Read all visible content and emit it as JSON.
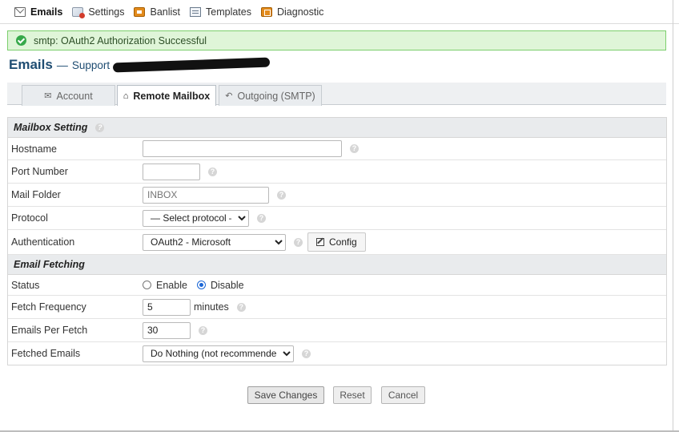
{
  "nav": {
    "items": [
      {
        "label": "Emails",
        "icon": "mail-icon",
        "active": true
      },
      {
        "label": "Settings",
        "icon": "settings-icon"
      },
      {
        "label": "Banlist",
        "icon": "banlist-icon"
      },
      {
        "label": "Templates",
        "icon": "templates-icon"
      },
      {
        "label": "Diagnostic",
        "icon": "diagnostic-icon"
      }
    ]
  },
  "alert": {
    "text": "smtp: OAuth2 Authorization Successful",
    "color": "#dff5d8"
  },
  "title": {
    "main": "Emails",
    "separator": "—",
    "sub": "Support"
  },
  "tabs": [
    {
      "label": "Account",
      "icon": "envelope-icon",
      "active": false
    },
    {
      "label": "Remote Mailbox",
      "icon": "inbox-icon",
      "active": true
    },
    {
      "label": "Outgoing (SMTP)",
      "icon": "reply-icon",
      "active": false
    }
  ],
  "sections": {
    "mailbox": {
      "title": "Mailbox Setting"
    },
    "fetching": {
      "title": "Email Fetching"
    }
  },
  "fields": {
    "hostname": {
      "label": "Hostname",
      "value": ""
    },
    "port": {
      "label": "Port Number",
      "value": ""
    },
    "folder": {
      "label": "Mail Folder",
      "placeholder": "INBOX"
    },
    "protocol": {
      "label": "Protocol",
      "selected": "— Select protocol —"
    },
    "auth": {
      "label": "Authentication",
      "selected": "OAuth2 - Microsoft",
      "config_label": "Config"
    },
    "status": {
      "label": "Status",
      "options": [
        "Enable",
        "Disable"
      ],
      "selected": "Disable"
    },
    "frequency": {
      "label": "Fetch Frequency",
      "value": "5",
      "unit": "minutes"
    },
    "per_fetch": {
      "label": "Emails Per Fetch",
      "value": "30"
    },
    "fetched": {
      "label": "Fetched Emails",
      "selected": "Do Nothing (not recommended)"
    }
  },
  "actions": {
    "save": "Save Changes",
    "reset": "Reset",
    "cancel": "Cancel"
  },
  "colors": {
    "accent": "#1f4d72",
    "success_border": "#7ccf6d",
    "radio_checked": "#1a66d6"
  }
}
